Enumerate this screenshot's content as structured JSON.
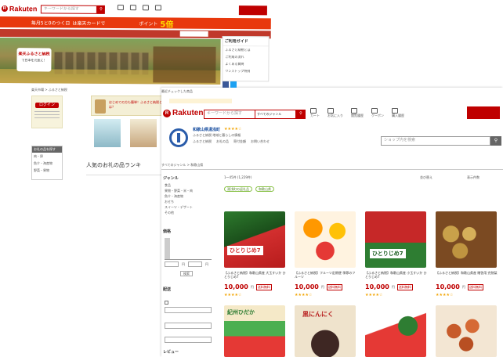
{
  "back": {
    "logo": "Rakuten",
    "search_placeholder": "キーワードから探す",
    "campaign_text": "毎月5と0のつく日",
    "campaign_sub": "は楽天カードで",
    "points_label": "ポイント",
    "points_big": "5倍",
    "furusato_title": "楽天ふるさと納税",
    "furusato_sub": "で日本を元気に！",
    "help_title": "ご利用ガイド",
    "help_items": [
      "ふるさと納税とは",
      "ご利用の流れ",
      "よくある質問",
      "ワンストップ特例"
    ],
    "login": "ログイン",
    "menu_title": "お礼の品を探す",
    "menu_items": [
      "肉・卵",
      "魚介・海産物",
      "野菜・果物"
    ],
    "promo1": "はじめての方も簡単！ふるさと納税とは？",
    "ranking": "人気のお礼の品ランキ",
    "breadcrumb": "楽天市場 > ふるさと納税"
  },
  "front": {
    "logo": "Rakuten",
    "search_placeholder": "キーワードから探す",
    "category_select": "すべてのジャンル",
    "breadcrumb": "すべてのジャンル > 和歌山県",
    "top_note": "最近チェックした商品",
    "shop_name": "和歌山県湯浅町",
    "shop_sub": "ふるさと納税 地域と暮らしの情報",
    "shop_menu": [
      "ふるさと納税",
      "お礼の品",
      "寄付金額",
      "お問い合わせ"
    ],
    "shop_search_placeholder": "ショップ内を検索",
    "header_icons": [
      "カート",
      "お気に入り",
      "閲覧履歴",
      "クーポン",
      "購入履歴"
    ],
    "genre_title": "ジャンル",
    "genre_items": [
      "食品",
      "果物・野菜・米・肉",
      "魚介・海産物",
      "おせち",
      "スイーツ・デザート",
      "その他"
    ],
    "price_title": "価格",
    "price_from": "円",
    "price_to": "円",
    "price_btn": "検索",
    "shipping_title": "配送",
    "review_title": "レビュー",
    "result_count": "1～45件 (1,229件)",
    "sort_label": "並び替え",
    "view_label": "表示件数",
    "filter_tags": [
      "湯浅町の返礼品",
      "和歌山県"
    ],
    "products": [
      {
        "img_text": "ひとりじめ7",
        "caption": "【ふるさと納税】和歌山県産 大玉すいか ひとりじめ7",
        "price": "10,000",
        "unit": "円"
      },
      {
        "img_text": "",
        "caption": "【ふるさと納税】フルーツ定期便 季節のフルーツ",
        "price": "10,000",
        "unit": "円"
      },
      {
        "img_text": "ひとりじめ7",
        "caption": "【ふるさと納税】和歌山県産 小玉すいか ひとりじめ7",
        "price": "10,000",
        "unit": "円"
      },
      {
        "img_text": "",
        "caption": "【ふるさと納税】和歌山県産 贈答用 完熟梨",
        "price": "10,000",
        "unit": "円"
      },
      {
        "img_text": "紀州ひだか",
        "caption": "",
        "price": "",
        "unit": ""
      },
      {
        "img_text": "黒にんにく",
        "caption": "",
        "price": "",
        "unit": ""
      },
      {
        "img_text": "",
        "caption": "",
        "price": "",
        "unit": ""
      },
      {
        "img_text": "",
        "caption": "",
        "price": "",
        "unit": ""
      }
    ],
    "badge": "送料無料"
  }
}
